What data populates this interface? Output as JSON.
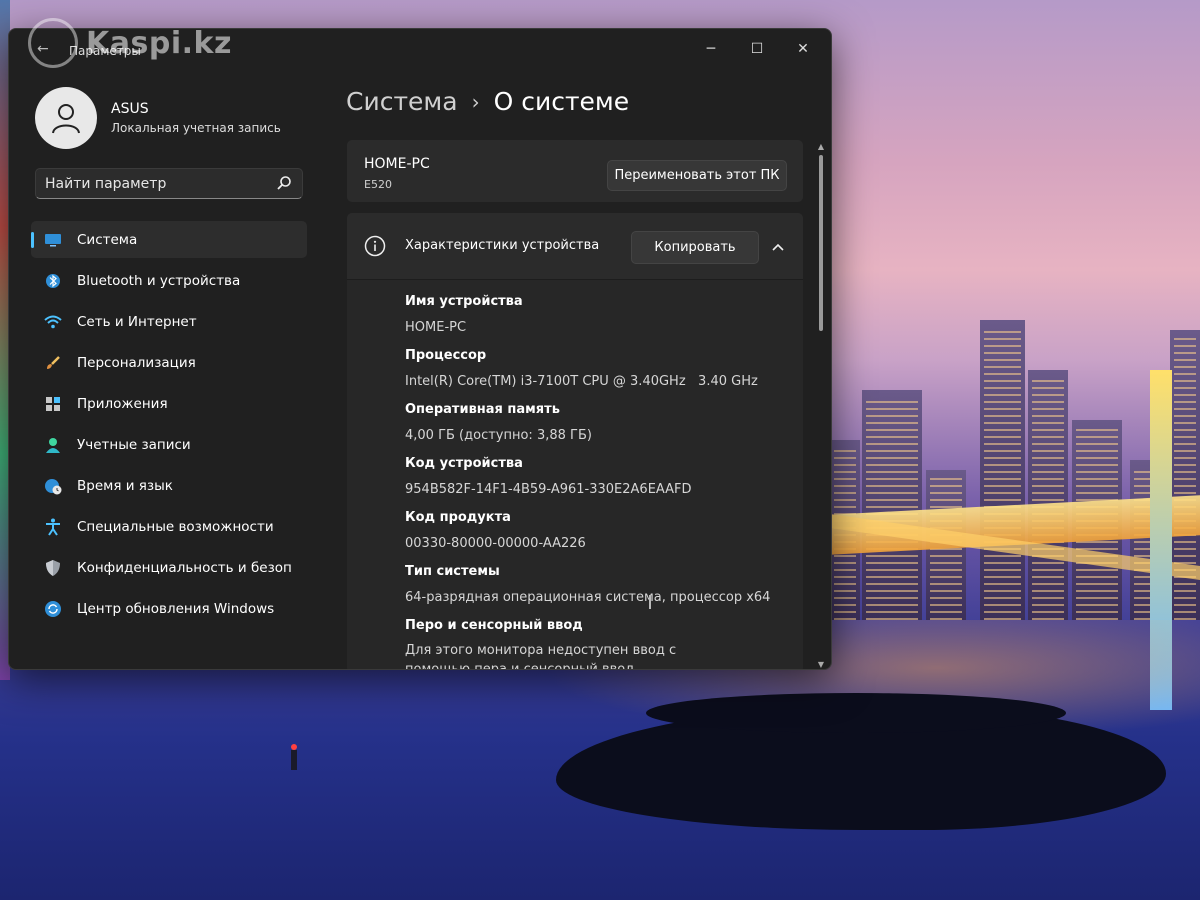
{
  "watermark": "Kaspi.kz",
  "window": {
    "app_title": "Параметры",
    "minimize": "─",
    "maximize": "☐",
    "close": "✕"
  },
  "profile": {
    "name": "ASUS",
    "subtitle": "Локальная учетная запись"
  },
  "search": {
    "placeholder": "Найти параметр"
  },
  "nav": {
    "items": [
      {
        "label": "Система",
        "icon": "monitor-icon",
        "active": true
      },
      {
        "label": "Bluetooth и устройства",
        "icon": "bluetooth-icon"
      },
      {
        "label": "Сеть и Интернет",
        "icon": "wifi-icon"
      },
      {
        "label": "Персонализация",
        "icon": "brush-icon"
      },
      {
        "label": "Приложения",
        "icon": "apps-icon"
      },
      {
        "label": "Учетные записи",
        "icon": "person-icon"
      },
      {
        "label": "Время и язык",
        "icon": "globe-clock-icon"
      },
      {
        "label": "Специальные возможности",
        "icon": "accessibility-icon"
      },
      {
        "label": "Конфиденциальность и безопасность",
        "icon": "shield-icon"
      },
      {
        "label": "Центр обновления Windows",
        "icon": "update-icon"
      }
    ]
  },
  "breadcrumb": {
    "parent": "Система",
    "separator": "›",
    "current": "О системе"
  },
  "pc_card": {
    "name": "HOME-PC",
    "model": "E520",
    "rename_label": "Переименовать этот ПК"
  },
  "specs_card": {
    "title": "Характеристики устройства",
    "copy_label": "Копировать",
    "items": [
      {
        "label": "Имя устройства",
        "value": "HOME-PC"
      },
      {
        "label": "Процессор",
        "value": "Intel(R) Core(TM) i3-7100T CPU @ 3.40GHz   3.40 GHz"
      },
      {
        "label": "Оперативная память",
        "value": "4,00 ГБ (доступно: 3,88 ГБ)"
      },
      {
        "label": "Код устройства",
        "value": "954B582F-14F1-4B59-A961-330E2A6EAAFD"
      },
      {
        "label": "Код продукта",
        "value": "00330-80000-00000-AA226"
      },
      {
        "label": "Тип системы",
        "value": "64-разрядная операционная система, процессор x64"
      },
      {
        "label": "Перо и сенсорный ввод",
        "value": "Для этого монитора недоступен ввод с помощью пера и сенсорный ввод"
      }
    ]
  },
  "colors": {
    "accent": "#4cc2ff",
    "window_bg": "#202020",
    "card_bg": "#2b2b2b"
  }
}
